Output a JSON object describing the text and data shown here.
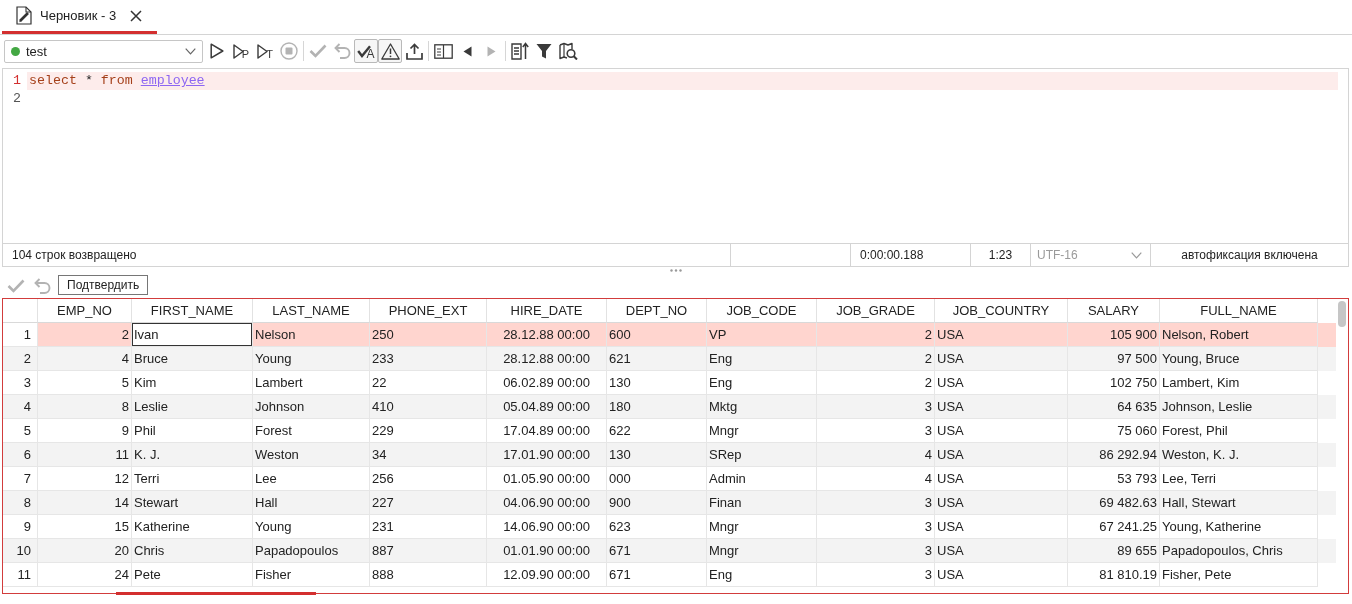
{
  "tabs": [
    {
      "title": "Черновик - 3",
      "selected": true
    }
  ],
  "toolbar": {
    "connection": {
      "value": "test",
      "connected": true
    },
    "groups": [
      [
        {
          "kind": "run",
          "disabled": false,
          "pressed": false
        },
        {
          "kind": "plan",
          "glyph": "P",
          "disabled": false,
          "pressed": false
        },
        {
          "kind": "trace",
          "glyph": "T",
          "disabled": false,
          "pressed": false
        },
        {
          "kind": "stop",
          "disabled": true,
          "pressed": false
        }
      ],
      [
        {
          "kind": "commit",
          "disabled": true,
          "pressed": false
        },
        {
          "kind": "rollback",
          "disabled": true,
          "pressed": false
        },
        {
          "kind": "autocommit",
          "glyph": "A",
          "disabled": false,
          "pressed": true
        },
        {
          "kind": "warnings",
          "disabled": false,
          "pressed": true
        },
        {
          "kind": "export",
          "disabled": false,
          "pressed": false
        }
      ],
      [
        {
          "kind": "panel",
          "disabled": false,
          "pressed": false
        },
        {
          "kind": "back",
          "disabled": false,
          "pressed": false
        },
        {
          "kind": "forward",
          "disabled": true,
          "pressed": false
        }
      ],
      [
        {
          "kind": "report",
          "disabled": false,
          "pressed": false
        },
        {
          "kind": "filter",
          "disabled": false,
          "pressed": false
        },
        {
          "kind": "find",
          "disabled": false,
          "pressed": false
        }
      ]
    ]
  },
  "editor": {
    "lines": [
      {
        "number": "1",
        "current": true,
        "tokens": [
          {
            "kind": "keyword",
            "text": "select"
          },
          {
            "kind": "symbol",
            "text": "*"
          },
          {
            "kind": "keyword",
            "text": "from"
          },
          {
            "kind": "table",
            "text": "employee"
          }
        ]
      },
      {
        "number": "2",
        "current": false
      }
    ]
  },
  "status_bar": {
    "message": "104 строк возвращено",
    "time": "0:00:00.188",
    "position": "1:23",
    "encoding": {
      "value": "UTF-16",
      "disabled": true
    },
    "autocommit": "автофиксация включена"
  },
  "results": {
    "actions": [
      {
        "kind": "commit",
        "disabled": true
      },
      {
        "kind": "rollback",
        "disabled": true
      }
    ],
    "tooltip": "Подтвердить",
    "columns": [
      {
        "name": "EMP_NO",
        "kind": "number"
      },
      {
        "name": "FIRST_NAME",
        "kind": "text"
      },
      {
        "name": "LAST_NAME",
        "kind": "text"
      },
      {
        "name": "PHONE_EXT",
        "kind": "text"
      },
      {
        "name": "HIRE_DATE",
        "kind": "date"
      },
      {
        "name": "DEPT_NO",
        "kind": "text"
      },
      {
        "name": "JOB_CODE",
        "kind": "text"
      },
      {
        "name": "JOB_GRADE",
        "kind": "number"
      },
      {
        "name": "JOB_COUNTRY",
        "kind": "text"
      },
      {
        "name": "SALARY",
        "kind": "number"
      },
      {
        "name": "FULL_NAME",
        "kind": "text"
      }
    ],
    "rows": [
      {
        "number": "1",
        "selected": true,
        "cells": [
          {
            "text": "2",
            "editing": false
          },
          {
            "text": "Ivan",
            "editing": true
          },
          {
            "text": "Nelson",
            "editing": false
          },
          {
            "text": "250",
            "editing": false
          },
          {
            "text": "28.12.88 00:00",
            "editing": false
          },
          {
            "text": "600",
            "editing": false
          },
          {
            "text": "VP",
            "editing": false
          },
          {
            "text": "2",
            "editing": false
          },
          {
            "text": "USA",
            "editing": false
          },
          {
            "text": "105 900",
            "editing": false
          },
          {
            "text": "Nelson, Robert",
            "editing": false
          }
        ]
      },
      {
        "number": "2",
        "selected": false,
        "cells": [
          {
            "text": "4",
            "editing": false
          },
          {
            "text": "Bruce",
            "editing": false
          },
          {
            "text": "Young",
            "editing": false
          },
          {
            "text": "233",
            "editing": false
          },
          {
            "text": "28.12.88 00:00",
            "editing": false
          },
          {
            "text": "621",
            "editing": false
          },
          {
            "text": "Eng",
            "editing": false
          },
          {
            "text": "2",
            "editing": false
          },
          {
            "text": "USA",
            "editing": false
          },
          {
            "text": "97 500",
            "editing": false
          },
          {
            "text": "Young, Bruce",
            "editing": false
          }
        ]
      },
      {
        "number": "3",
        "selected": false,
        "cells": [
          {
            "text": "5",
            "editing": false
          },
          {
            "text": "Kim",
            "editing": false
          },
          {
            "text": "Lambert",
            "editing": false
          },
          {
            "text": "22",
            "editing": false
          },
          {
            "text": "06.02.89 00:00",
            "editing": false
          },
          {
            "text": "130",
            "editing": false
          },
          {
            "text": "Eng",
            "editing": false
          },
          {
            "text": "2",
            "editing": false
          },
          {
            "text": "USA",
            "editing": false
          },
          {
            "text": "102 750",
            "editing": false
          },
          {
            "text": "Lambert, Kim",
            "editing": false
          }
        ]
      },
      {
        "number": "4",
        "selected": false,
        "cells": [
          {
            "text": "8",
            "editing": false
          },
          {
            "text": "Leslie",
            "editing": false
          },
          {
            "text": "Johnson",
            "editing": false
          },
          {
            "text": "410",
            "editing": false
          },
          {
            "text": "05.04.89 00:00",
            "editing": false
          },
          {
            "text": "180",
            "editing": false
          },
          {
            "text": "Mktg",
            "editing": false
          },
          {
            "text": "3",
            "editing": false
          },
          {
            "text": "USA",
            "editing": false
          },
          {
            "text": "64 635",
            "editing": false
          },
          {
            "text": "Johnson, Leslie",
            "editing": false
          }
        ]
      },
      {
        "number": "5",
        "selected": false,
        "cells": [
          {
            "text": "9",
            "editing": false
          },
          {
            "text": "Phil",
            "editing": false
          },
          {
            "text": "Forest",
            "editing": false
          },
          {
            "text": "229",
            "editing": false
          },
          {
            "text": "17.04.89 00:00",
            "editing": false
          },
          {
            "text": "622",
            "editing": false
          },
          {
            "text": "Mngr",
            "editing": false
          },
          {
            "text": "3",
            "editing": false
          },
          {
            "text": "USA",
            "editing": false
          },
          {
            "text": "75 060",
            "editing": false
          },
          {
            "text": "Forest, Phil",
            "editing": false
          }
        ]
      },
      {
        "number": "6",
        "selected": false,
        "cells": [
          {
            "text": "11",
            "editing": false
          },
          {
            "text": "K. J.",
            "editing": false
          },
          {
            "text": "Weston",
            "editing": false
          },
          {
            "text": "34",
            "editing": false
          },
          {
            "text": "17.01.90 00:00",
            "editing": false
          },
          {
            "text": "130",
            "editing": false
          },
          {
            "text": "SRep",
            "editing": false
          },
          {
            "text": "4",
            "editing": false
          },
          {
            "text": "USA",
            "editing": false
          },
          {
            "text": "86 292.94",
            "editing": false
          },
          {
            "text": "Weston, K. J.",
            "editing": false
          }
        ]
      },
      {
        "number": "7",
        "selected": false,
        "cells": [
          {
            "text": "12",
            "editing": false
          },
          {
            "text": "Terri",
            "editing": false
          },
          {
            "text": "Lee",
            "editing": false
          },
          {
            "text": "256",
            "editing": false
          },
          {
            "text": "01.05.90 00:00",
            "editing": false
          },
          {
            "text": "000",
            "editing": false
          },
          {
            "text": "Admin",
            "editing": false
          },
          {
            "text": "4",
            "editing": false
          },
          {
            "text": "USA",
            "editing": false
          },
          {
            "text": "53 793",
            "editing": false
          },
          {
            "text": "Lee, Terri",
            "editing": false
          }
        ]
      },
      {
        "number": "8",
        "selected": false,
        "cells": [
          {
            "text": "14",
            "editing": false
          },
          {
            "text": "Stewart",
            "editing": false
          },
          {
            "text": "Hall",
            "editing": false
          },
          {
            "text": "227",
            "editing": false
          },
          {
            "text": "04.06.90 00:00",
            "editing": false
          },
          {
            "text": "900",
            "editing": false
          },
          {
            "text": "Finan",
            "editing": false
          },
          {
            "text": "3",
            "editing": false
          },
          {
            "text": "USA",
            "editing": false
          },
          {
            "text": "69 482.63",
            "editing": false
          },
          {
            "text": "Hall, Stewart",
            "editing": false
          }
        ]
      },
      {
        "number": "9",
        "selected": false,
        "cells": [
          {
            "text": "15",
            "editing": false
          },
          {
            "text": "Katherine",
            "editing": false
          },
          {
            "text": "Young",
            "editing": false
          },
          {
            "text": "231",
            "editing": false
          },
          {
            "text": "14.06.90 00:00",
            "editing": false
          },
          {
            "text": "623",
            "editing": false
          },
          {
            "text": "Mngr",
            "editing": false
          },
          {
            "text": "3",
            "editing": false
          },
          {
            "text": "USA",
            "editing": false
          },
          {
            "text": "67 241.25",
            "editing": false
          },
          {
            "text": "Young, Katherine",
            "editing": false
          }
        ]
      },
      {
        "number": "10",
        "selected": false,
        "cells": [
          {
            "text": "20",
            "editing": false
          },
          {
            "text": "Chris",
            "editing": false
          },
          {
            "text": "Papadopoulos",
            "editing": false
          },
          {
            "text": "887",
            "editing": false
          },
          {
            "text": "01.01.90 00:00",
            "editing": false
          },
          {
            "text": "671",
            "editing": false
          },
          {
            "text": "Mngr",
            "editing": false
          },
          {
            "text": "3",
            "editing": false
          },
          {
            "text": "USA",
            "editing": false
          },
          {
            "text": "89 655",
            "editing": false
          },
          {
            "text": "Papadopoulos, Chris",
            "editing": false
          }
        ]
      },
      {
        "number": "11",
        "selected": false,
        "cells": [
          {
            "text": "24",
            "editing": false
          },
          {
            "text": "Pete",
            "editing": false
          },
          {
            "text": "Fisher",
            "editing": false
          },
          {
            "text": "888",
            "editing": false
          },
          {
            "text": "12.09.90 00:00",
            "editing": false
          },
          {
            "text": "671",
            "editing": false
          },
          {
            "text": "Eng",
            "editing": false
          },
          {
            "text": "3",
            "editing": false
          },
          {
            "text": "USA",
            "editing": false
          },
          {
            "text": "81 810.19",
            "editing": false
          },
          {
            "text": "Fisher, Pete",
            "editing": false
          }
        ]
      }
    ]
  }
}
